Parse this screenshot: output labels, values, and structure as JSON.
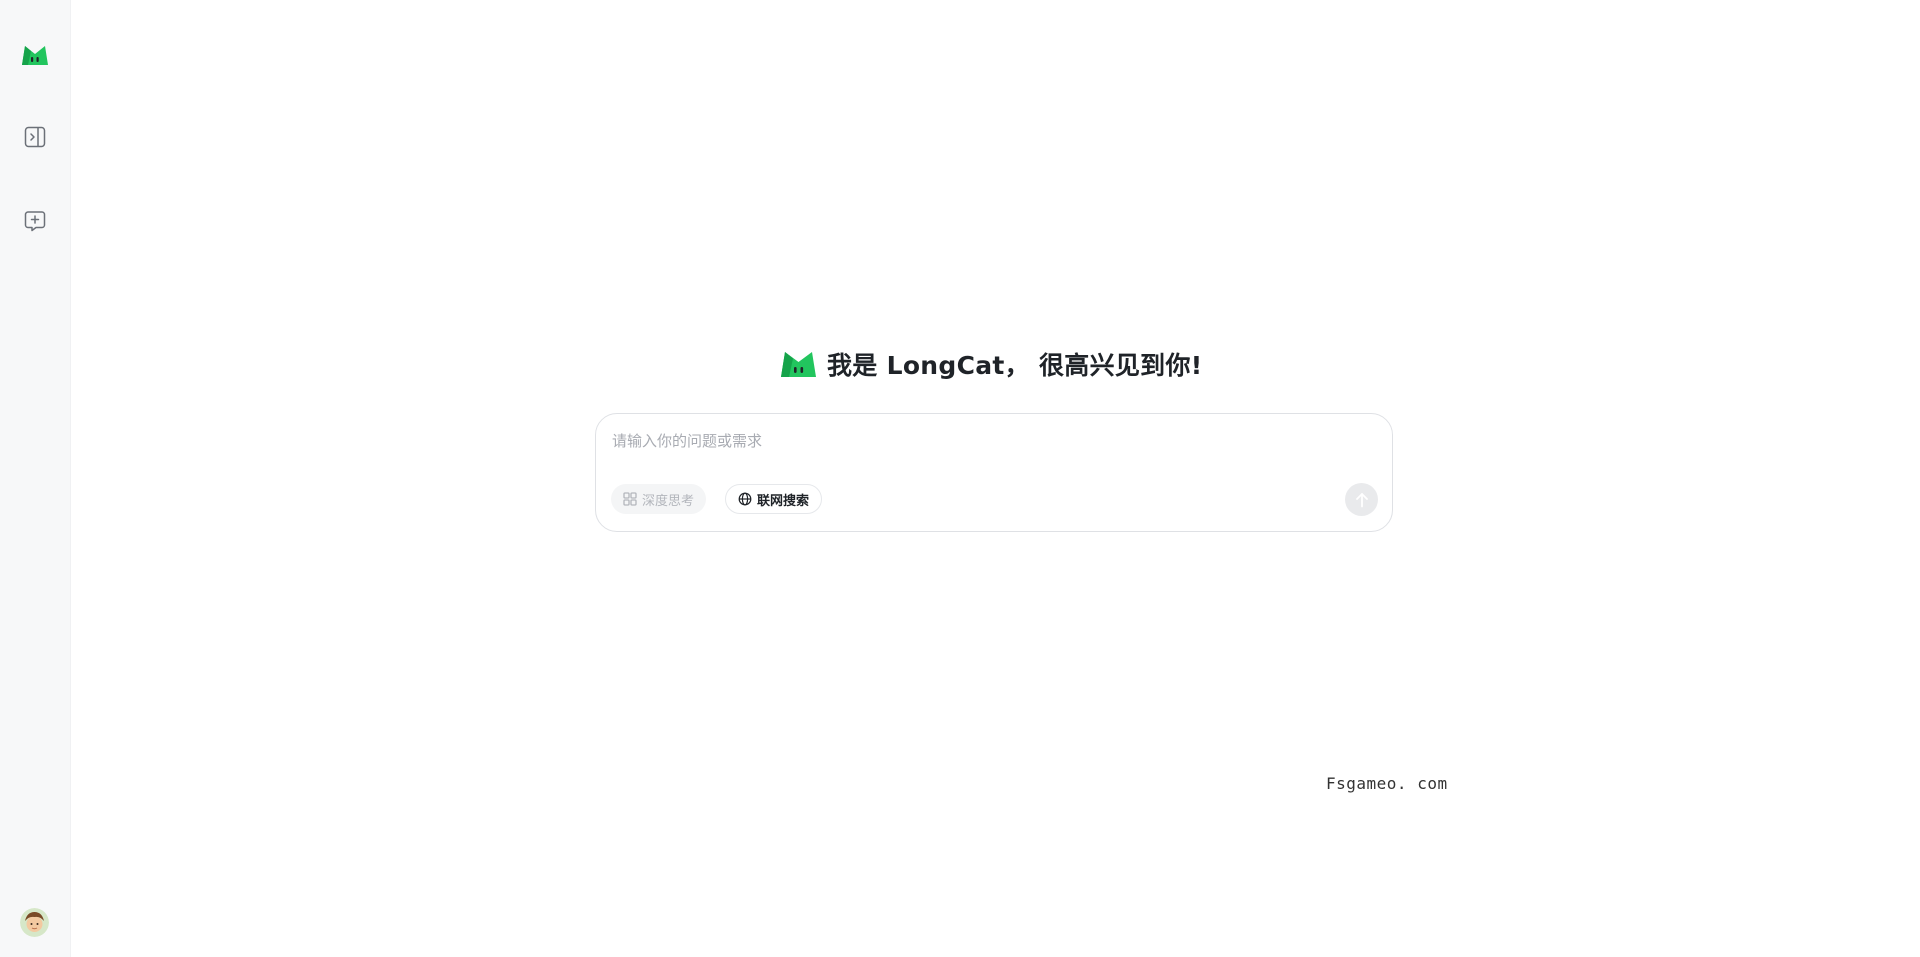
{
  "app": {
    "name": "LongCat",
    "accent_color": "#22c55e"
  },
  "sidebar": {
    "logo_icon": "longcat-logo-icon",
    "toggle_icon": "sidebar-expand-icon",
    "new_chat_icon": "new-chat-icon",
    "avatar_icon": "user-avatar"
  },
  "hero": {
    "title": "我是 LongCat， 很高兴见到你!"
  },
  "composer": {
    "placeholder": "请输入你的问题或需求",
    "value": "",
    "deep_think_label": "深度思考",
    "deep_think_icon": "grid-icon",
    "web_search_label": "联网搜索",
    "web_search_icon": "globe-icon",
    "send_icon": "arrow-up-icon"
  },
  "watermark": {
    "text": "Fsgameo. com"
  }
}
